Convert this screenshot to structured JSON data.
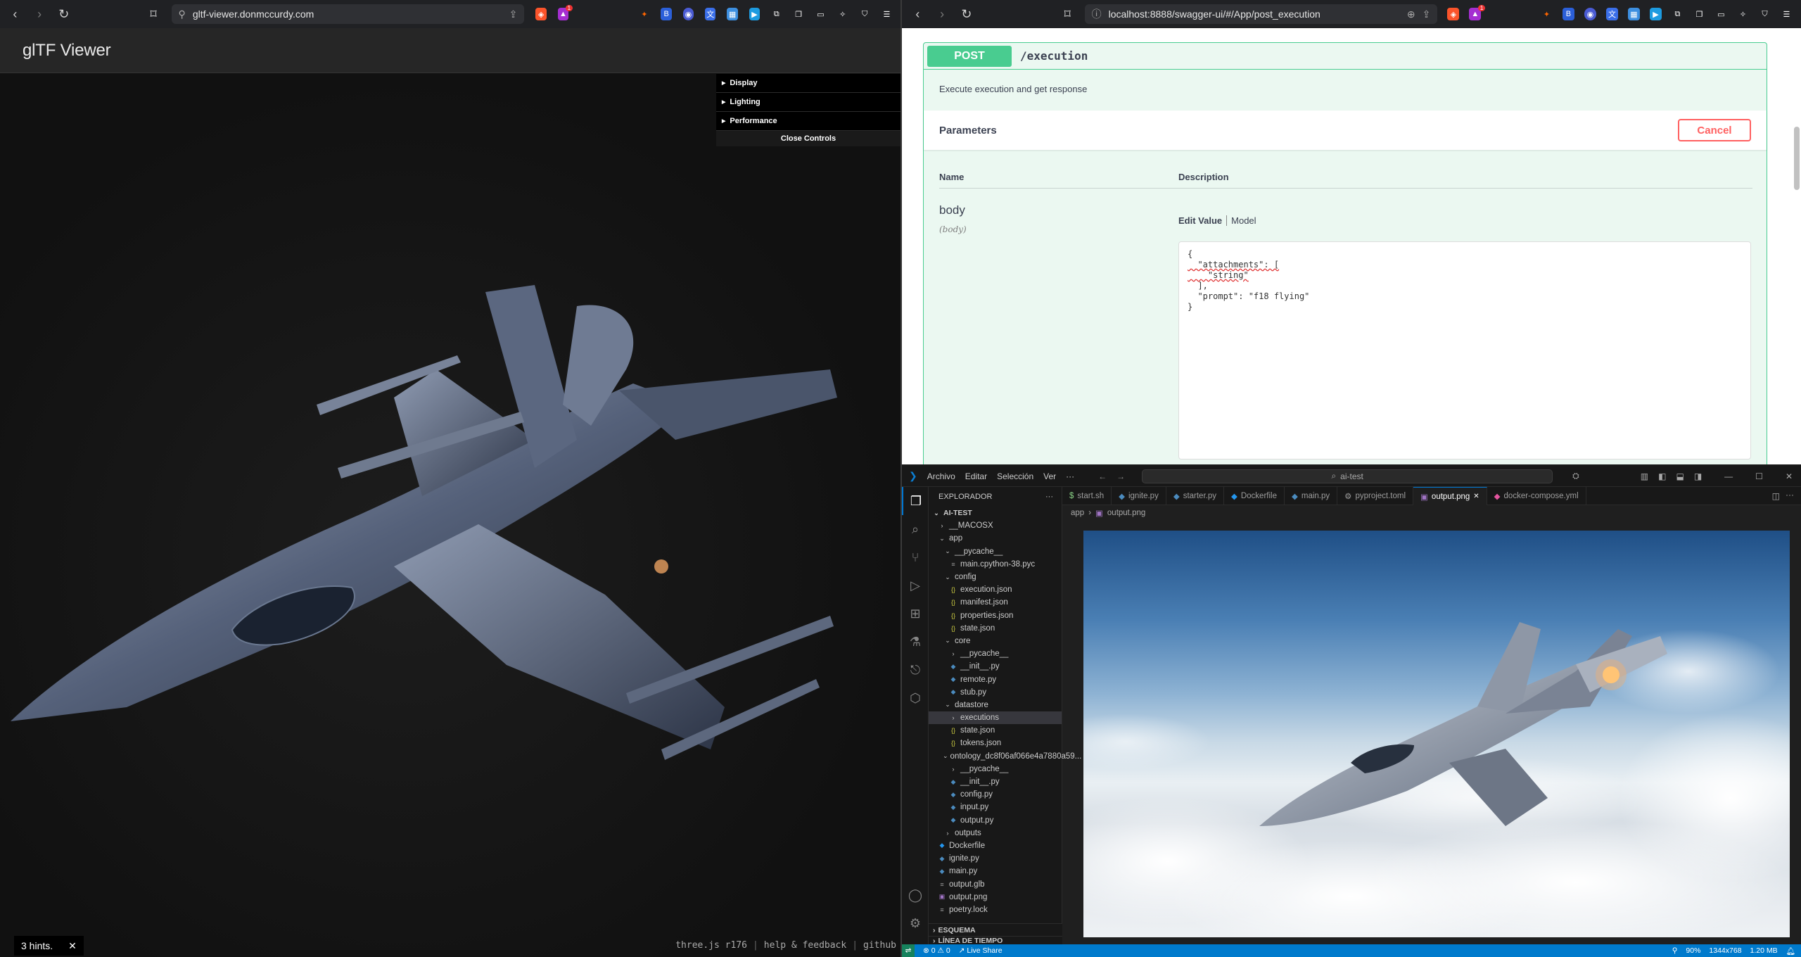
{
  "left_browser": {
    "url": "gltf-viewer.donmccurdy.com",
    "app_title": "glTF Viewer",
    "controls": {
      "folders": [
        {
          "label": "Display"
        },
        {
          "label": "Lighting"
        },
        {
          "label": "Performance"
        }
      ],
      "close_label": "Close Controls"
    },
    "hints": {
      "label": "3 hints.",
      "close": "✕"
    },
    "footer": {
      "version": "three.js r176",
      "help": "help & feedback",
      "github": "github"
    },
    "notification_count": "1"
  },
  "right_browser": {
    "url": "localhost:8888/swagger-ui/#/App/post_execution",
    "notification_count": "1",
    "operation": {
      "method": "POST",
      "path": "/execution",
      "description": "Execute execution and get response",
      "parameters_title": "Parameters",
      "cancel_label": "Cancel",
      "col_name": "Name",
      "col_description": "Description",
      "param_name": "body",
      "param_in": "(body)",
      "tab_edit": "Edit Value",
      "tab_model": "Model",
      "body_lines": [
        "{",
        "  \"attachments\": [",
        "    \"string\"",
        "  ],",
        "  \"prompt\": \"f18 flying\"",
        "}"
      ]
    }
  },
  "vscode": {
    "menu": [
      "Archivo",
      "Editar",
      "Selección",
      "Ver",
      "···"
    ],
    "search_text": "ai-test",
    "explorer_title": "EXPLORADOR",
    "workspace": "AI-TEST",
    "tree": [
      {
        "label": "__MACOSX",
        "type": "folder-closed",
        "depth": 1
      },
      {
        "label": "app",
        "type": "folder-open",
        "depth": 1
      },
      {
        "label": "__pycache__",
        "type": "folder-open",
        "depth": 2
      },
      {
        "label": "main.cpython-38.pyc",
        "type": "file-bin",
        "depth": 3
      },
      {
        "label": "config",
        "type": "folder-open",
        "depth": 2
      },
      {
        "label": "execution.json",
        "type": "file-json",
        "depth": 3
      },
      {
        "label": "manifest.json",
        "type": "file-json",
        "depth": 3
      },
      {
        "label": "properties.json",
        "type": "file-json",
        "depth": 3
      },
      {
        "label": "state.json",
        "type": "file-json",
        "depth": 3
      },
      {
        "label": "core",
        "type": "folder-open",
        "depth": 2
      },
      {
        "label": "__pycache__",
        "type": "folder-closed",
        "depth": 3
      },
      {
        "label": "__init__.py",
        "type": "file-py",
        "depth": 3
      },
      {
        "label": "remote.py",
        "type": "file-py",
        "depth": 3
      },
      {
        "label": "stub.py",
        "type": "file-py",
        "depth": 3
      },
      {
        "label": "datastore",
        "type": "folder-open",
        "depth": 2
      },
      {
        "label": "executions",
        "type": "folder-closed",
        "depth": 3,
        "selected": true
      },
      {
        "label": "state.json",
        "type": "file-json",
        "depth": 3
      },
      {
        "label": "tokens.json",
        "type": "file-json",
        "depth": 3
      },
      {
        "label": "ontology_dc8f06af066e4a7880a59...",
        "type": "folder-open",
        "depth": 2
      },
      {
        "label": "__pycache__",
        "type": "folder-closed",
        "depth": 3
      },
      {
        "label": "__init__.py",
        "type": "file-py",
        "depth": 3
      },
      {
        "label": "config.py",
        "type": "file-py",
        "depth": 3
      },
      {
        "label": "input.py",
        "type": "file-py",
        "depth": 3
      },
      {
        "label": "output.py",
        "type": "file-py",
        "depth": 3
      },
      {
        "label": "outputs",
        "type": "folder-closed",
        "depth": 2
      },
      {
        "label": "Dockerfile",
        "type": "file-docker",
        "depth": 1
      },
      {
        "label": "ignite.py",
        "type": "file-py",
        "depth": 1
      },
      {
        "label": "main.py",
        "type": "file-py",
        "depth": 1
      },
      {
        "label": "output.glb",
        "type": "file-bin",
        "depth": 1
      },
      {
        "label": "output.png",
        "type": "file-img",
        "depth": 1
      },
      {
        "label": "poetry.lock",
        "type": "file-bin",
        "depth": 1
      }
    ],
    "sections": [
      "ESQUEMA",
      "LÍNEA DE TIEMPO"
    ],
    "tabs": [
      {
        "label": "start.sh",
        "icon": "$",
        "color": "#89d185"
      },
      {
        "label": "ignite.py",
        "icon": "◆",
        "color": "#4b8bbe"
      },
      {
        "label": "starter.py",
        "icon": "◆",
        "color": "#4b8bbe"
      },
      {
        "label": "Dockerfile",
        "icon": "◆",
        "color": "#2496ed"
      },
      {
        "label": "main.py",
        "icon": "◆",
        "color": "#4b8bbe"
      },
      {
        "label": "pyproject.toml",
        "icon": "⚙",
        "color": "#9c9c9c"
      },
      {
        "label": "output.png",
        "icon": "▣",
        "color": "#a074c4",
        "active": true
      },
      {
        "label": "docker-compose.yml",
        "icon": "◆",
        "color": "#e5559f"
      }
    ],
    "breadcrumb": [
      "app",
      "output.png"
    ],
    "status": {
      "errors": "0",
      "warnings": "0",
      "live_share": "Live Share",
      "zoom": "90%",
      "dimensions": "1344x768",
      "size": "1.20 MB",
      "bell_count": "1"
    }
  }
}
